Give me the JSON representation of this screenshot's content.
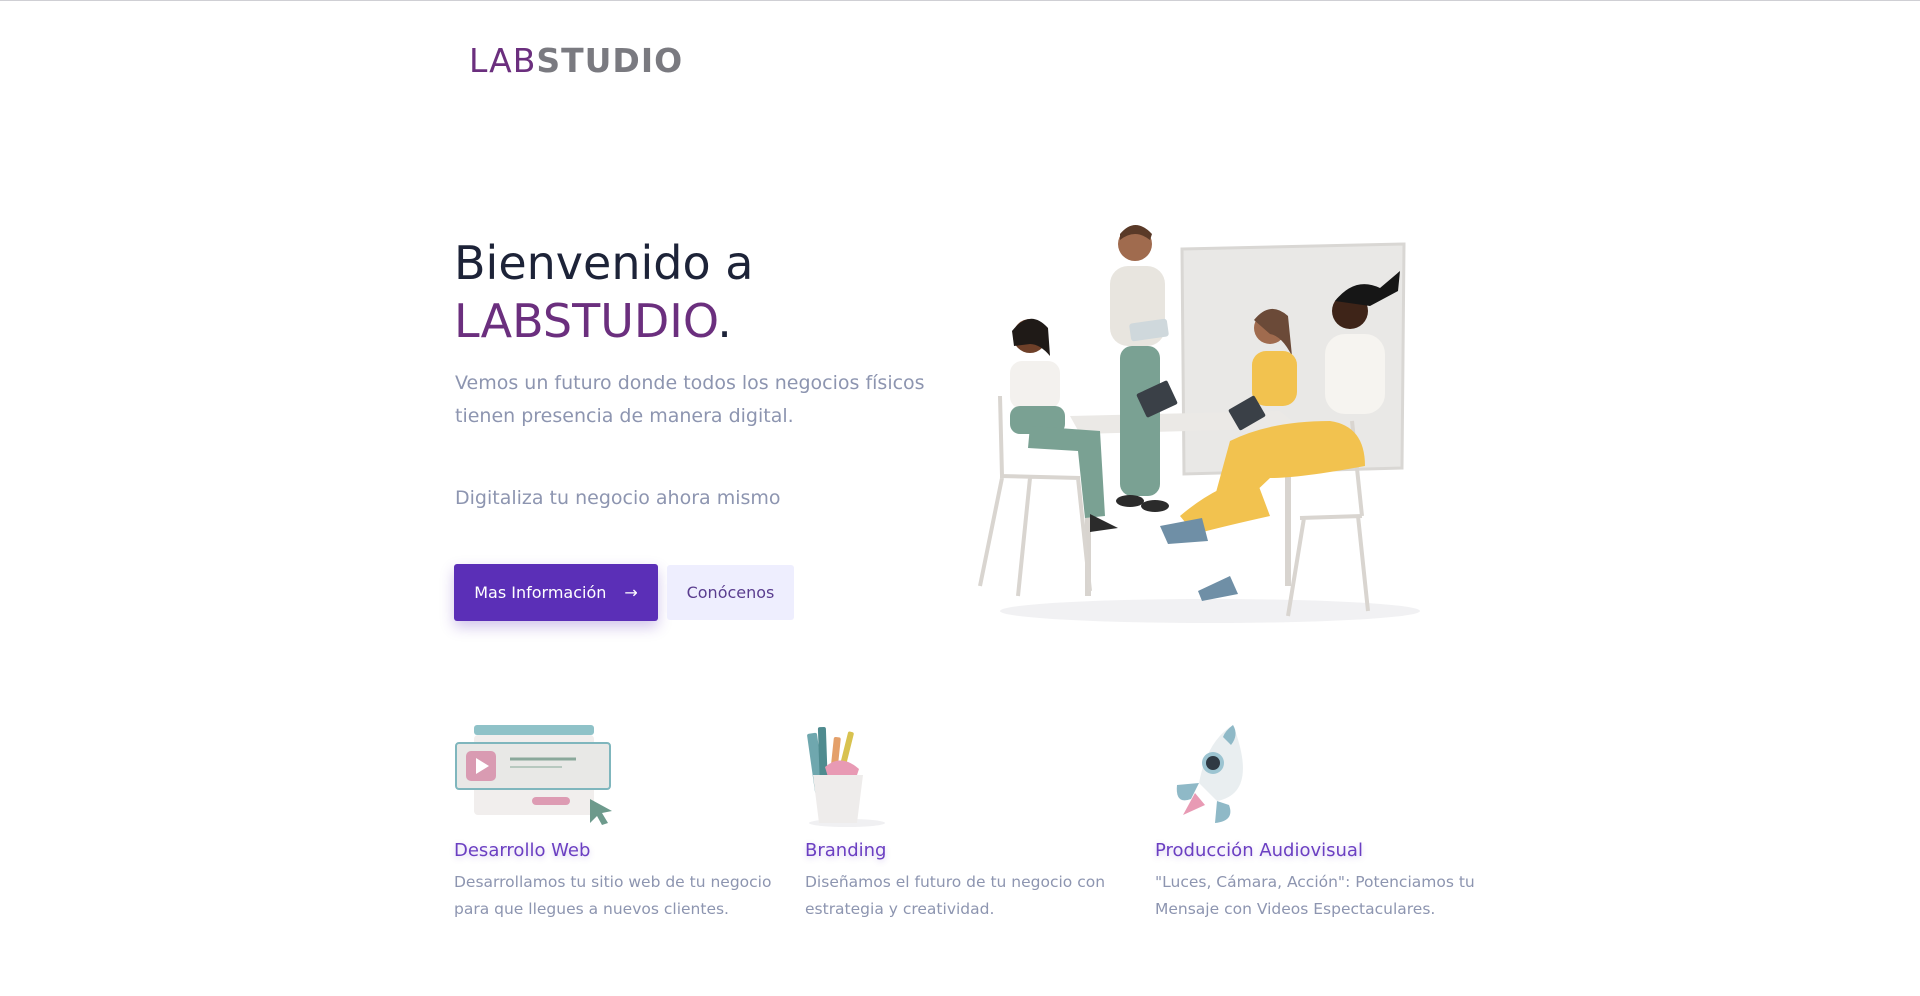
{
  "header": {
    "logo_part1": "LAB",
    "logo_part2": "STUDIO"
  },
  "hero": {
    "title_line1": "Bienvenido a",
    "title_brand": "LABSTUDIO",
    "title_period": ".",
    "subtitle": "Vemos un futuro donde todos los negocios físicos tienen presencia de manera digital.",
    "cta_text": "Digitaliza tu negocio ahora mismo",
    "primary_button_label": "Mas Información",
    "primary_button_icon": "arrow-right-icon",
    "secondary_button_label": "Conócenos",
    "illustration": "team-meeting-illustration"
  },
  "features": [
    {
      "icon": "web-development-icon",
      "title": "Desarrollo Web",
      "description": "Desarrollamos tu sitio web de tu negocio para que llegues a nuevos clientes."
    },
    {
      "icon": "branding-pencil-cup-icon",
      "title": "Branding",
      "description": "Diseñamos el futuro de tu negocio con estrategia y creatividad."
    },
    {
      "icon": "rocket-icon",
      "title": "Producción Audiovisual",
      "description": "\"Luces, Cámara, Acción\": Potenciamos tu Mensaje con Videos Espectaculares."
    }
  ],
  "colors": {
    "brand_purple": "#6b2f7e",
    "primary_button": "#5b2fb7",
    "secondary_button_bg": "#eeeefe",
    "text_muted": "#8d95b0",
    "heading_dark": "#1d2338",
    "feature_title": "#6b3fc2"
  }
}
